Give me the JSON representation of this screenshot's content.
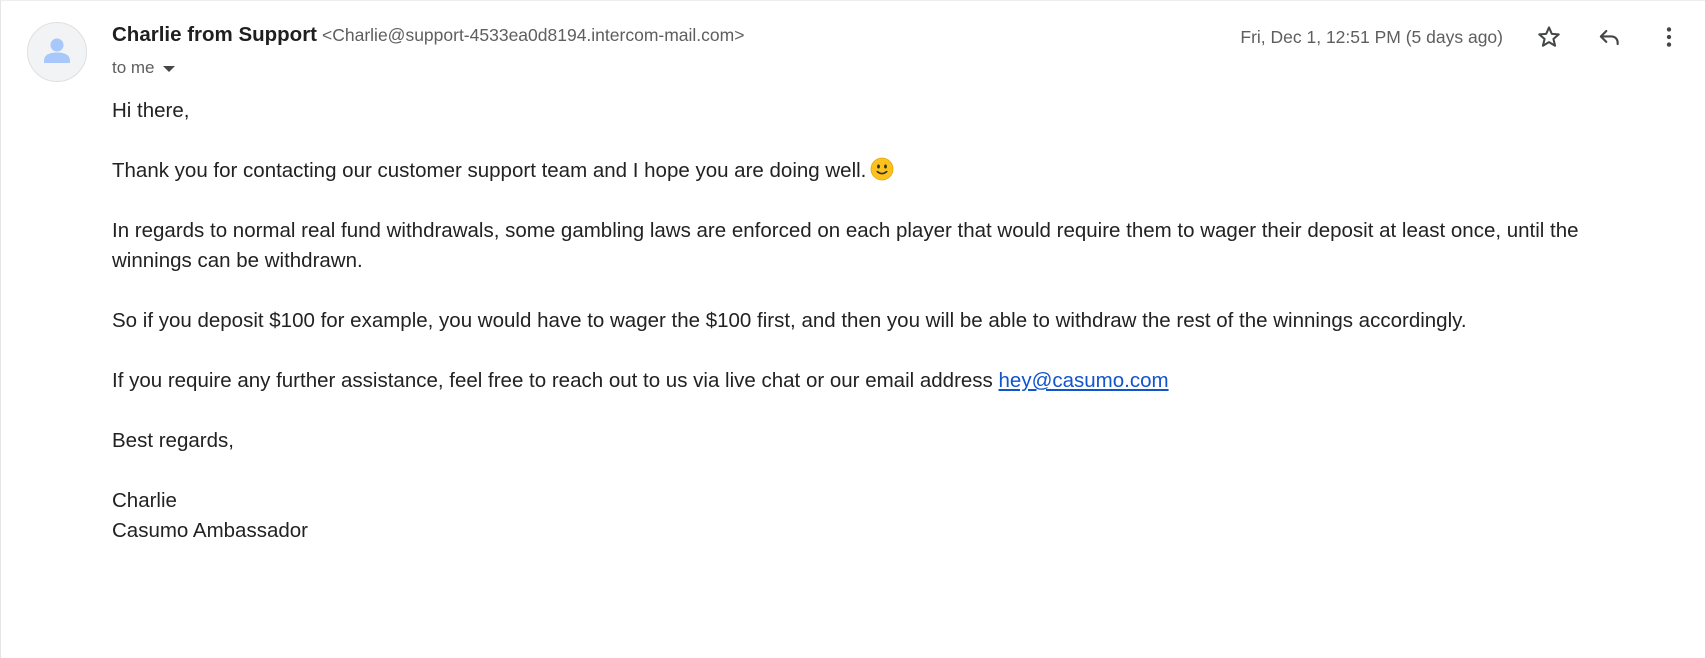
{
  "header": {
    "sender_name": "Charlie from Support",
    "sender_email": "<Charlie@support-4533ea0d8194.intercom-mail.com>",
    "to_label": "to me",
    "timestamp": "Fri, Dec 1, 12:51 PM (5 days ago)"
  },
  "icons": {
    "avatar": "person-icon",
    "star": "star-icon",
    "reply": "reply-icon",
    "more": "more-vert-icon",
    "dropdown": "chevron-down-icon",
    "emoji": "slightly-smiling-face-emoji"
  },
  "colors": {
    "link": "#1155cc",
    "avatar_figure": "#a8c7fa",
    "avatar_bg": "#f1f3f4"
  },
  "message": {
    "greeting": "Hi there,",
    "p1": "Thank you for contacting our customer support team and I hope you are doing well.",
    "p2": "In regards to normal real fund withdrawals, some gambling laws are enforced on each player that would require them to wager their deposit at least once, until the winnings can be withdrawn.",
    "p3": "So if you deposit $100 for example, you would have to wager the $100 first, and then you will be able to withdraw the rest of the winnings accordingly.",
    "p4_text": "If you require any further assistance, feel free to reach out to us via live chat or our email address",
    "p4_link": "hey@casumo.com",
    "closing": "Best regards,",
    "signature_name": "Charlie",
    "signature_title": "Casumo Ambassador"
  }
}
